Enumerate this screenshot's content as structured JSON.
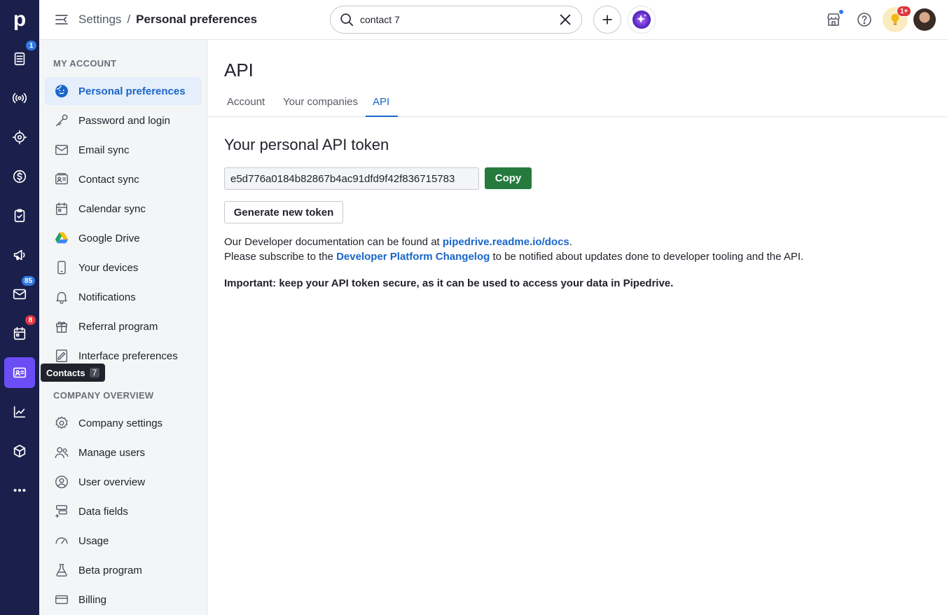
{
  "rail": {
    "logo": "p",
    "items": [
      {
        "name": "leads-icon",
        "badge": "1"
      },
      {
        "name": "campaigns-broadcast-icon"
      },
      {
        "name": "target-icon"
      },
      {
        "name": "deals-dollar-icon"
      },
      {
        "name": "activities-clipboard-icon"
      },
      {
        "name": "megaphone-icon"
      },
      {
        "name": "mail-icon",
        "badge": "85"
      },
      {
        "name": "calendar-icon",
        "badge": "8"
      },
      {
        "name": "contacts-card-icon"
      },
      {
        "name": "insights-chart-icon"
      },
      {
        "name": "products-box-icon"
      },
      {
        "name": "more-icon"
      }
    ],
    "tooltip": {
      "label": "Contacts",
      "shortcut": "7"
    }
  },
  "topbar": {
    "breadcrumb_parent": "Settings",
    "breadcrumb_sep": "/",
    "breadcrumb_current": "Personal preferences",
    "search_value": "contact 7",
    "notifications_badge": "1+"
  },
  "sidebar": {
    "my_account_title": "MY ACCOUNT",
    "my_account_items": [
      {
        "label": "Personal preferences",
        "icon": "face-icon",
        "active": true
      },
      {
        "label": "Password and login",
        "icon": "key-icon"
      },
      {
        "label": "Email sync",
        "icon": "envelope-icon"
      },
      {
        "label": "Contact sync",
        "icon": "contact-card-icon"
      },
      {
        "label": "Calendar sync",
        "icon": "calendar-icon"
      },
      {
        "label": "Google Drive",
        "icon": "google-drive-icon"
      },
      {
        "label": "Your devices",
        "icon": "phone-icon"
      },
      {
        "label": "Notifications",
        "icon": "bell-icon"
      },
      {
        "label": "Referral program",
        "icon": "gift-icon"
      },
      {
        "label": "Interface preferences",
        "icon": "interface-icon"
      }
    ],
    "company_title": "COMPANY OVERVIEW",
    "company_items": [
      {
        "label": "Company settings",
        "icon": "gear-icon"
      },
      {
        "label": "Manage users",
        "icon": "users-icon"
      },
      {
        "label": "User overview",
        "icon": "user-circle-icon"
      },
      {
        "label": "Data fields",
        "icon": "data-fields-icon"
      },
      {
        "label": "Usage",
        "icon": "gauge-icon"
      },
      {
        "label": "Beta program",
        "icon": "flask-icon"
      },
      {
        "label": "Billing",
        "icon": "credit-card-icon"
      }
    ]
  },
  "main": {
    "title": "API",
    "tabs": [
      "Account",
      "Your companies",
      "API"
    ],
    "section_title": "Your personal API token",
    "token": "e5d776a0184b82867b4ac91dfd9f42f836715783",
    "copy_label": "Copy",
    "generate_label": "Generate new token",
    "doc_text_before": "Our Developer documentation can be found at ",
    "doc_link": "pipedrive.readme.io/docs",
    "doc_text_after": ".",
    "sub_text_before": "Please subscribe to the ",
    "sub_link": "Developer Platform Changelog",
    "sub_text_after": " to be notified about updates done to developer tooling and the API.",
    "important": "Important: keep your API token secure, as it can be used to access your data in Pipedrive."
  },
  "colors": {
    "rail_bg": "#1b1f4b",
    "accent": "#1a66c9",
    "copy_green": "#267a3e",
    "rail_active": "#6b4df5"
  }
}
